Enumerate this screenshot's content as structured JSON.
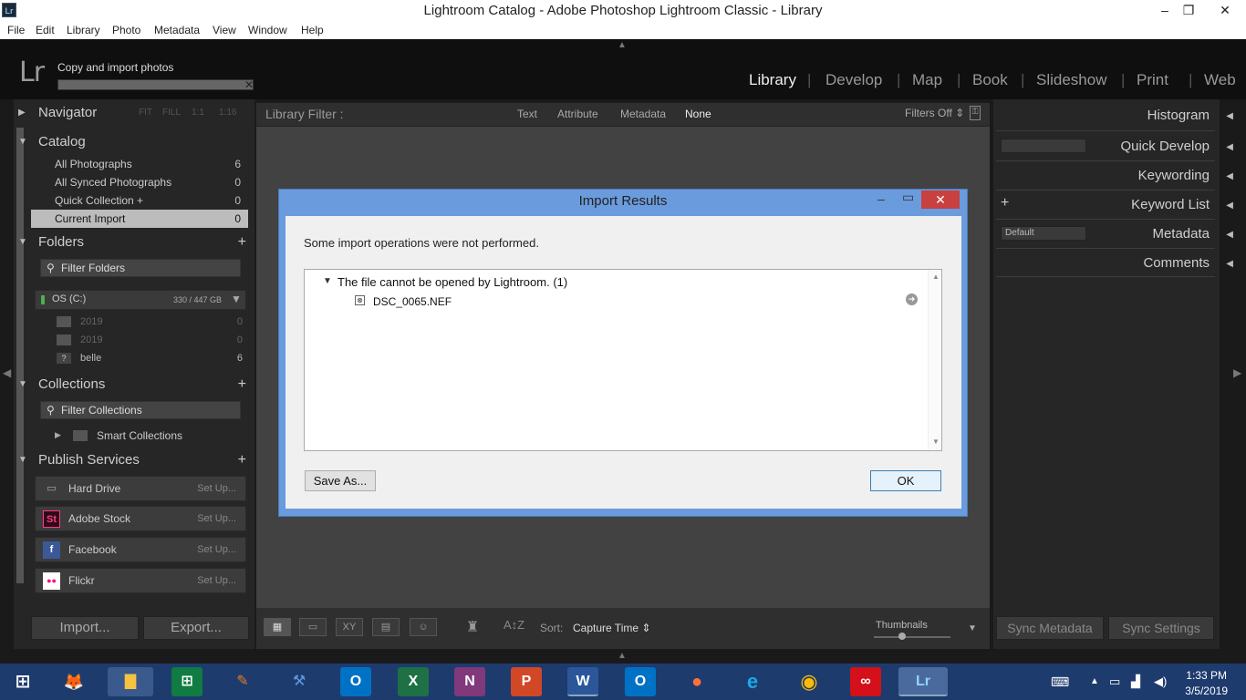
{
  "window": {
    "title": "Lightroom Catalog - Adobe Photoshop Lightroom Classic - Library",
    "app_icon": "Lr",
    "minimize": "–",
    "restore": "❐",
    "close": "✕"
  },
  "menu": [
    "File",
    "Edit",
    "Library",
    "Photo",
    "Metadata",
    "View",
    "Window",
    "Help"
  ],
  "identity": {
    "logo": "Lr",
    "progress_label": "Copy and import photos",
    "progress_close": "✕"
  },
  "modules": [
    "Library",
    "Develop",
    "Map",
    "Book",
    "Slideshow",
    "Print",
    "Web"
  ],
  "modules_sep": "|",
  "left": {
    "navigator": {
      "label": "Navigator",
      "zoom": [
        "FIT",
        "FILL",
        "1:1",
        "1:16"
      ]
    },
    "catalog": {
      "label": "Catalog",
      "items": [
        {
          "label": "All Photographs",
          "count": "6"
        },
        {
          "label": "All Synced Photographs",
          "count": "0"
        },
        {
          "label": "Quick Collection  +",
          "count": "0"
        },
        {
          "label": "Current Import",
          "count": "0"
        }
      ]
    },
    "folders": {
      "label": "Folders",
      "filter": "Filter Folders",
      "volume": "OS (C:)",
      "volume_size": "330 / 447 GB",
      "items": [
        {
          "label": "2019",
          "count": "0"
        },
        {
          "label": "2019",
          "count": "0"
        },
        {
          "label": "belle",
          "count": "6"
        }
      ]
    },
    "collections": {
      "label": "Collections",
      "filter": "Filter Collections",
      "smart": "Smart Collections"
    },
    "publish": {
      "label": "Publish Services",
      "items": [
        {
          "label": "Hard Drive",
          "icon": "▭",
          "setup": "Set Up..."
        },
        {
          "label": "Adobe Stock",
          "icon": "St",
          "setup": "Set Up..."
        },
        {
          "label": "Facebook",
          "icon": "f",
          "setup": "Set Up..."
        },
        {
          "label": "Flickr",
          "icon": "●●",
          "setup": "Set Up..."
        }
      ]
    },
    "import_btn": "Import...",
    "export_btn": "Export..."
  },
  "filter": {
    "label": "Library Filter :",
    "options": [
      "Text",
      "Attribute",
      "Metadata",
      "None"
    ],
    "filters_off": "Filters Off ⇕"
  },
  "right": {
    "panels": [
      "Histogram",
      "Quick Develop",
      "Keywording",
      "Keyword List",
      "Metadata",
      "Comments"
    ],
    "metadata_preset": "Default",
    "sync_metadata": "Sync Metadata",
    "sync_settings": "Sync Settings"
  },
  "toolbar": {
    "sort_label": "Sort:",
    "sort_value": "Capture Time ⇕",
    "thumbnails_label": "Thumbnails"
  },
  "dialog": {
    "title": "Import Results",
    "message": "Some import operations were not performed.",
    "group": "The file cannot be opened by Lightroom. (1)",
    "file": "DSC_0065.NEF",
    "save_as": "Save As...",
    "ok": "OK",
    "minimize": "–",
    "maximize": "▭",
    "close": "✕"
  },
  "taskbar": {
    "time": "1:33 PM",
    "date": "3/5/2019"
  }
}
